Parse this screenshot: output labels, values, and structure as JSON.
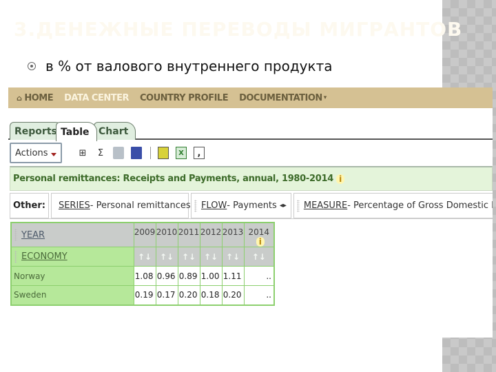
{
  "slide": {
    "title": "3.ДЕНЕЖНЫЕ ПЕРЕВОДЫ МИГРАНТОВ",
    "bullet_icon": "radio-bullet-icon",
    "bullet_text": "в % от валового внутреннего продукта"
  },
  "nav": {
    "items": [
      {
        "label": "HOME",
        "icon": "home-icon",
        "active": false
      },
      {
        "label": "DATA CENTER",
        "active": true
      },
      {
        "label": "COUNTRY PROFILE",
        "active": false
      },
      {
        "label": "DOCUMENTATION",
        "dropdown": true,
        "active": false
      }
    ],
    "home_glyph": "⌂",
    "caret_glyph": "▾"
  },
  "tabs": [
    {
      "label": "Reports",
      "active": false
    },
    {
      "label": "Table",
      "active": true
    },
    {
      "label": "Chart",
      "active": false
    }
  ],
  "toolbar": {
    "actions_label": "Actions",
    "icons": [
      {
        "name": "layout-icon",
        "glyph": "⊞"
      },
      {
        "name": "sum-icon",
        "glyph": "Σ"
      },
      {
        "name": "print-icon",
        "glyph": ""
      },
      {
        "name": "save-icon",
        "glyph": ""
      },
      {
        "name": "export-pdf-icon",
        "glyph": ""
      },
      {
        "name": "export-excel-icon",
        "glyph": "X"
      },
      {
        "name": "export-csv-icon",
        "glyph": ","
      }
    ]
  },
  "report_title": "Personal remittances: Receipts and Payments, annual, 1980-2014",
  "info_glyph": "i",
  "filters": {
    "label": "Other:",
    "series": {
      "key": "SERIES",
      "value": " - Personal remittances"
    },
    "flow": {
      "key": "FLOW",
      "value": " - Payments",
      "arrows": "◂▸"
    },
    "measure": {
      "key": "MEASURE",
      "value": " - Percentage of Gross Domestic Product"
    }
  },
  "table": {
    "row_dim": "ECONOMY",
    "col_dim": "YEAR",
    "years": [
      "2009",
      "2010",
      "2011",
      "2012",
      "2013",
      "2014"
    ],
    "sort_glyph": "↑↓",
    "rows": [
      {
        "label": "Norway",
        "values": [
          "1.08",
          "0.96",
          "0.89",
          "1.00",
          "1.11",
          ".."
        ]
      },
      {
        "label": "Sweden",
        "values": [
          "0.19",
          "0.17",
          "0.20",
          "0.18",
          "0.20",
          ".."
        ]
      }
    ]
  }
}
